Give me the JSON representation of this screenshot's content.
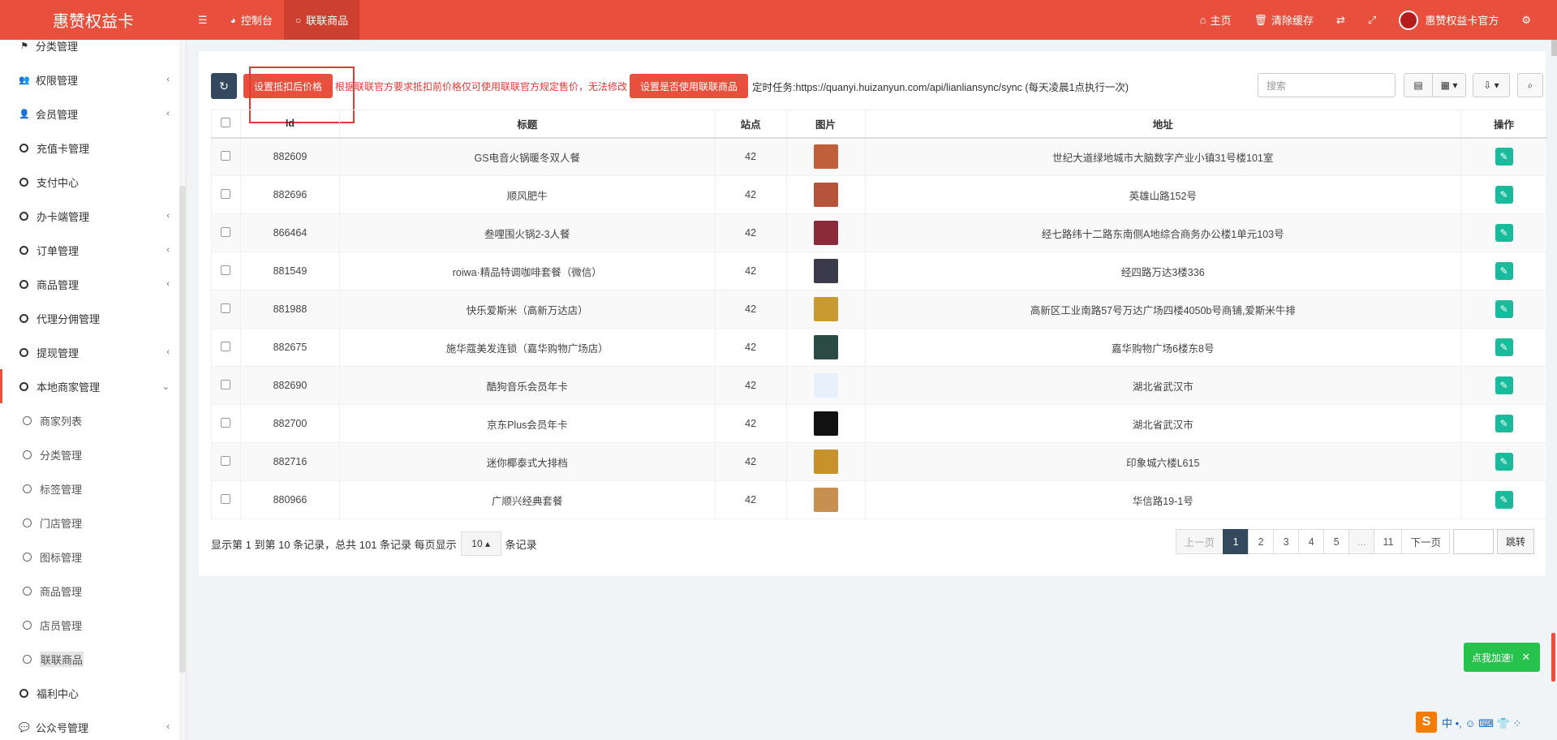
{
  "topbar": {
    "brand": "惠赞权益卡",
    "menu_icon": "☰",
    "nav": [
      {
        "icon": "dashboard-icon",
        "glyph": "◕",
        "label": "控制台"
      },
      {
        "icon": "circle-icon",
        "glyph": "○",
        "label": "联联商品"
      }
    ],
    "right": [
      {
        "icon": "home-icon",
        "glyph": "⌂",
        "label": "主页"
      },
      {
        "icon": "trash-icon",
        "glyph": "🗑",
        "label": "清除缓存"
      },
      {
        "icon": "translate-icon",
        "glyph": "⇄",
        "label": ""
      },
      {
        "icon": "fullscreen-icon",
        "glyph": "⤢",
        "label": ""
      }
    ],
    "user_name": "惠赞权益卡官方",
    "settings_glyph": "⚙"
  },
  "sidebar": {
    "items": [
      {
        "label": "分类管理",
        "type": "icon",
        "glyph": "⚑",
        "arrow": ""
      },
      {
        "label": "权限管理",
        "type": "icon",
        "glyph": "👥",
        "arrow": "‹"
      },
      {
        "label": "会员管理",
        "type": "icon",
        "glyph": "👤",
        "arrow": "‹"
      },
      {
        "label": "充值卡管理",
        "type": "circle",
        "arrow": ""
      },
      {
        "label": "支付中心",
        "type": "circle",
        "arrow": ""
      },
      {
        "label": "办卡端管理",
        "type": "circle",
        "arrow": "‹"
      },
      {
        "label": "订单管理",
        "type": "circle",
        "arrow": "‹"
      },
      {
        "label": "商品管理",
        "type": "circle",
        "arrow": "‹"
      },
      {
        "label": "代理分佣管理",
        "type": "circle",
        "arrow": ""
      },
      {
        "label": "提现管理",
        "type": "circle",
        "arrow": "‹"
      },
      {
        "label": "本地商家管理",
        "type": "circle",
        "arrow": "⌄"
      },
      {
        "label": "商家列表",
        "type": "sub",
        "arrow": ""
      },
      {
        "label": "分类管理",
        "type": "sub",
        "arrow": ""
      },
      {
        "label": "标签管理",
        "type": "sub",
        "arrow": ""
      },
      {
        "label": "门店管理",
        "type": "sub",
        "arrow": ""
      },
      {
        "label": "图标管理",
        "type": "sub",
        "arrow": ""
      },
      {
        "label": "商品管理",
        "type": "sub",
        "arrow": ""
      },
      {
        "label": "店员管理",
        "type": "sub",
        "arrow": ""
      },
      {
        "label": "联联商品",
        "type": "current",
        "arrow": ""
      },
      {
        "label": "福利中心",
        "type": "circle",
        "arrow": ""
      },
      {
        "label": "公众号管理",
        "type": "icon",
        "glyph": "💬",
        "arrow": "‹"
      }
    ]
  },
  "toolbar": {
    "refresh_glyph": "↻",
    "set_price_label": "设置抵扣后价格",
    "notice": "根据联联官方要求抵扣前价格仅可使用联联官方规定售价，无法修改",
    "set_use_label": "设置是否使用联联商品",
    "cron_text": "定时任务:https://quanyi.huizanyun.com/api/lianliansync/sync (每天凌晨1点执行一次)",
    "search_placeholder": "搜索",
    "search_glyph": "⌕"
  },
  "table": {
    "headers": [
      "Id",
      "标题",
      "站点",
      "图片",
      "地址",
      "操作"
    ],
    "rows": [
      {
        "id": "882609",
        "title": "GS电音火锅暖冬双人餐",
        "site": "42",
        "addr": "世纪大道绿地城市大脑数字产业小镇31号楼101室",
        "color": "#c0603a"
      },
      {
        "id": "882696",
        "title": "顺风肥牛",
        "site": "42",
        "addr": "英雄山路152号",
        "color": "#b5533c"
      },
      {
        "id": "866464",
        "title": "叁哩围火锅2-3人餐",
        "site": "42",
        "addr": "经七路纬十二路东南侧A地综合商务办公楼1单元103号",
        "color": "#8a2a3a"
      },
      {
        "id": "881549",
        "title": "roiwa·精品特调咖啡套餐（微信）",
        "site": "42",
        "addr": "经四路万达3楼336",
        "color": "#3a3a4a"
      },
      {
        "id": "881988",
        "title": "快乐爱斯米（高新万达店）",
        "site": "42",
        "addr": "高新区工业南路57号万达广场四楼4050b号商铺,爱斯米牛排",
        "color": "#c89a30"
      },
      {
        "id": "882675",
        "title": "施华蔻美发连锁（嘉华购物广场店）",
        "site": "42",
        "addr": "嘉华购物广场6楼东8号",
        "color": "#2c4a44"
      },
      {
        "id": "882690",
        "title": "酷狗音乐会员年卡",
        "site": "42",
        "addr": "湖北省武汉市",
        "color": "#e8f0fb"
      },
      {
        "id": "882700",
        "title": "京东Plus会员年卡",
        "site": "42",
        "addr": "湖北省武汉市",
        "color": "#111111"
      },
      {
        "id": "882716",
        "title": "迷你椰泰式大排档",
        "site": "42",
        "addr": "印象城六楼L615",
        "color": "#c8922a"
      },
      {
        "id": "880966",
        "title": "广顺兴经典套餐",
        "site": "42",
        "addr": "华信路19-1号",
        "color": "#c89050"
      }
    ],
    "edit_glyph": "✎"
  },
  "footer": {
    "info_prefix": "显示第 1 到第 10 条记录，总共 101 条记录 每页显示",
    "page_size": "10",
    "info_suffix": "条记录",
    "prev": "上一页",
    "pages": [
      "1",
      "2",
      "3",
      "4",
      "5",
      "...",
      "11"
    ],
    "next": "下一页",
    "jump": "跳转"
  },
  "floating": {
    "speed_label": "点我加速!",
    "close": "✕",
    "ime_s": "S",
    "ime_text": "中 •, ☺ ⌨ 👕 ⁘"
  }
}
